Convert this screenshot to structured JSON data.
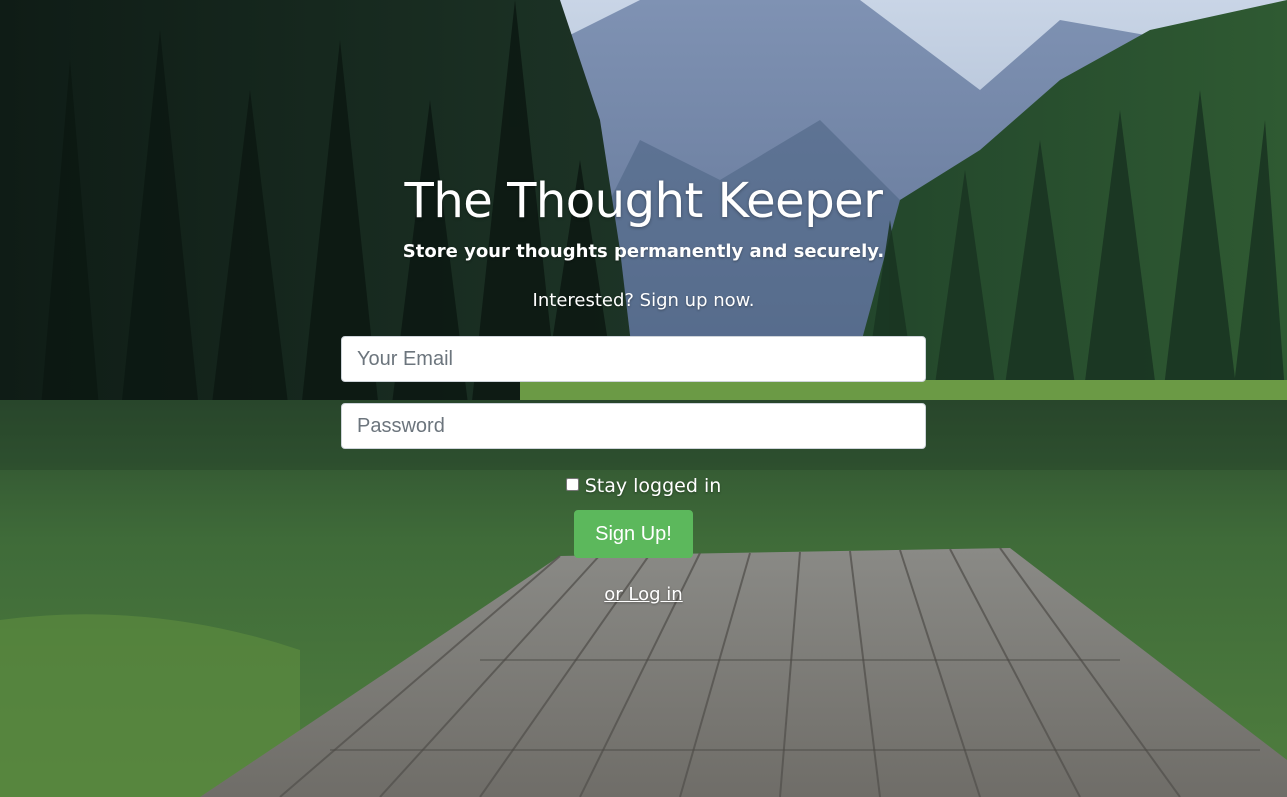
{
  "header": {
    "title": "The Thought Keeper",
    "subtitle": "Store your thoughts permanently and securely."
  },
  "signup_form": {
    "prompt": "Interested? Sign up now.",
    "email_placeholder": "Your Email",
    "password_placeholder": "Password",
    "stay_logged_in_label": "Stay logged in",
    "submit_label": "Sign Up!",
    "login_link_label": "or Log in"
  },
  "colors": {
    "accent_green": "#5cb85c",
    "text": "#ffffff",
    "field_background": "#ffffff"
  },
  "background": {
    "subject": "mountain-lake-with-wooden-dock"
  }
}
